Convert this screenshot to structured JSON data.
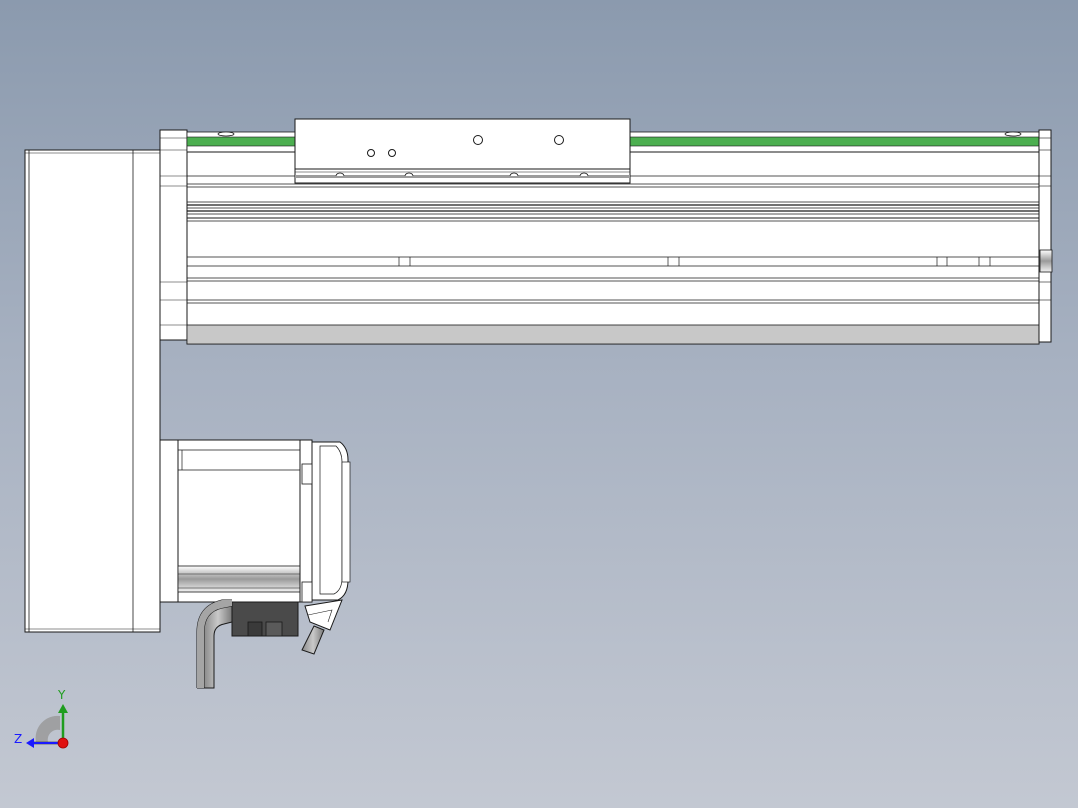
{
  "view": {
    "background_top": "#8b9aae",
    "background_bottom": "#c3c8d2"
  },
  "triad": {
    "horizontal_axis_label": "Z",
    "vertical_axis_label": "Y",
    "colors": {
      "horizontal_axis": "#1a1aff",
      "vertical_axis": "#1f9d1f",
      "origin": "#e01010"
    }
  },
  "model": {
    "rail_color": "#4caf50",
    "body_color": "#ffffff",
    "edge_color": "#1a1a1a",
    "shade_color": "#c8c8c8",
    "dark_color": "#4a4a4a"
  }
}
